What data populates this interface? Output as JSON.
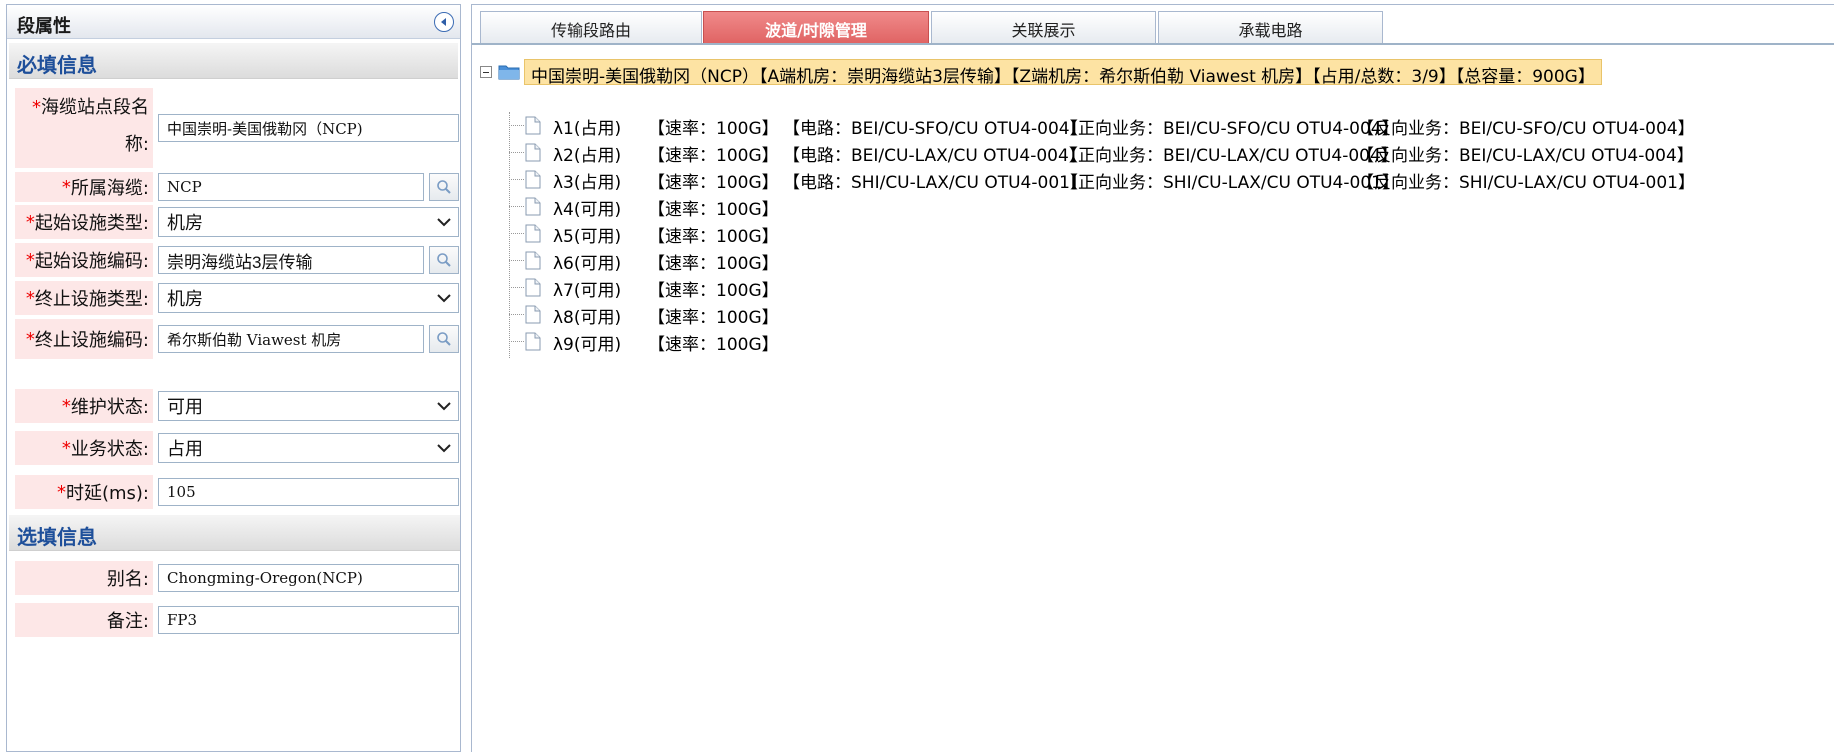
{
  "left_panel": {
    "title": "段属性",
    "required_section": "必填信息",
    "optional_section": "选填信息",
    "fields": {
      "segment_name": {
        "label_line1": "海缆站点段名",
        "label_line2": "称:",
        "value": "中国崇明-美国俄勒冈（NCP)"
      },
      "cable": {
        "label": "所属海缆:",
        "value": "NCP"
      },
      "start_type": {
        "label": "起始设施类型:",
        "value": "机房"
      },
      "start_code": {
        "label": "起始设施编码:",
        "value": "崇明海缆站3层传输"
      },
      "end_type": {
        "label": "终止设施类型:",
        "value": "机房"
      },
      "end_code": {
        "label": "终止设施编码:",
        "value": "希尔斯伯勒 Viawest 机房"
      },
      "maint_status": {
        "label": "维护状态:",
        "value": "可用"
      },
      "service_status": {
        "label": "业务状态:",
        "value": "占用"
      },
      "delay": {
        "label": "时延(ms):",
        "value": "105"
      },
      "alias": {
        "label": "别名:",
        "value": "Chongming-Oregon(NCP)"
      },
      "remark": {
        "label": "备注:",
        "value": "FP3"
      }
    }
  },
  "tabs": [
    {
      "label": "传输段路由"
    },
    {
      "label": "波道/时隙管理"
    },
    {
      "label": "关联展示"
    },
    {
      "label": "承载电路"
    }
  ],
  "tree": {
    "root_label": "中国崇明-美国俄勒冈（NCP）【A端机房：崇明海缆站3层传输】【Z端机房：希尔斯伯勒 Viawest 机房】【占用/总数：3/9】【总容量：900G】",
    "rows": [
      {
        "name": "λ1(占用)",
        "rate": "【速率：100G】",
        "circuit": "【电路：BEI/CU-SFO/CU OTU4-004】",
        "forward": "【正向业务：BEI/CU-SFO/CU OTU4-004】",
        "reverse": "【反向业务：BEI/CU-SFO/CU OTU4-004】"
      },
      {
        "name": "λ2(占用)",
        "rate": "【速率：100G】",
        "circuit": "【电路：BEI/CU-LAX/CU OTU4-004】",
        "forward": "【正向业务：BEI/CU-LAX/CU OTU4-004】",
        "reverse": "【反向业务：BEI/CU-LAX/CU OTU4-004】"
      },
      {
        "name": "λ3(占用)",
        "rate": "【速率：100G】",
        "circuit": "【电路：SHI/CU-LAX/CU OTU4-001】",
        "forward": "【正向业务：SHI/CU-LAX/CU OTU4-001】",
        "reverse": "【反向业务：SHI/CU-LAX/CU OTU4-001】"
      },
      {
        "name": "λ4(可用)",
        "rate": "【速率：100G】",
        "circuit": "",
        "forward": "",
        "reverse": ""
      },
      {
        "name": "λ5(可用)",
        "rate": "【速率：100G】",
        "circuit": "",
        "forward": "",
        "reverse": ""
      },
      {
        "name": "λ6(可用)",
        "rate": "【速率：100G】",
        "circuit": "",
        "forward": "",
        "reverse": ""
      },
      {
        "name": "λ7(可用)",
        "rate": "【速率：100G】",
        "circuit": "",
        "forward": "",
        "reverse": ""
      },
      {
        "name": "λ8(可用)",
        "rate": "【速率：100G】",
        "circuit": "",
        "forward": "",
        "reverse": ""
      },
      {
        "name": "λ9(可用)",
        "rate": "【速率：100G】",
        "circuit": "",
        "forward": "",
        "reverse": ""
      }
    ]
  }
}
